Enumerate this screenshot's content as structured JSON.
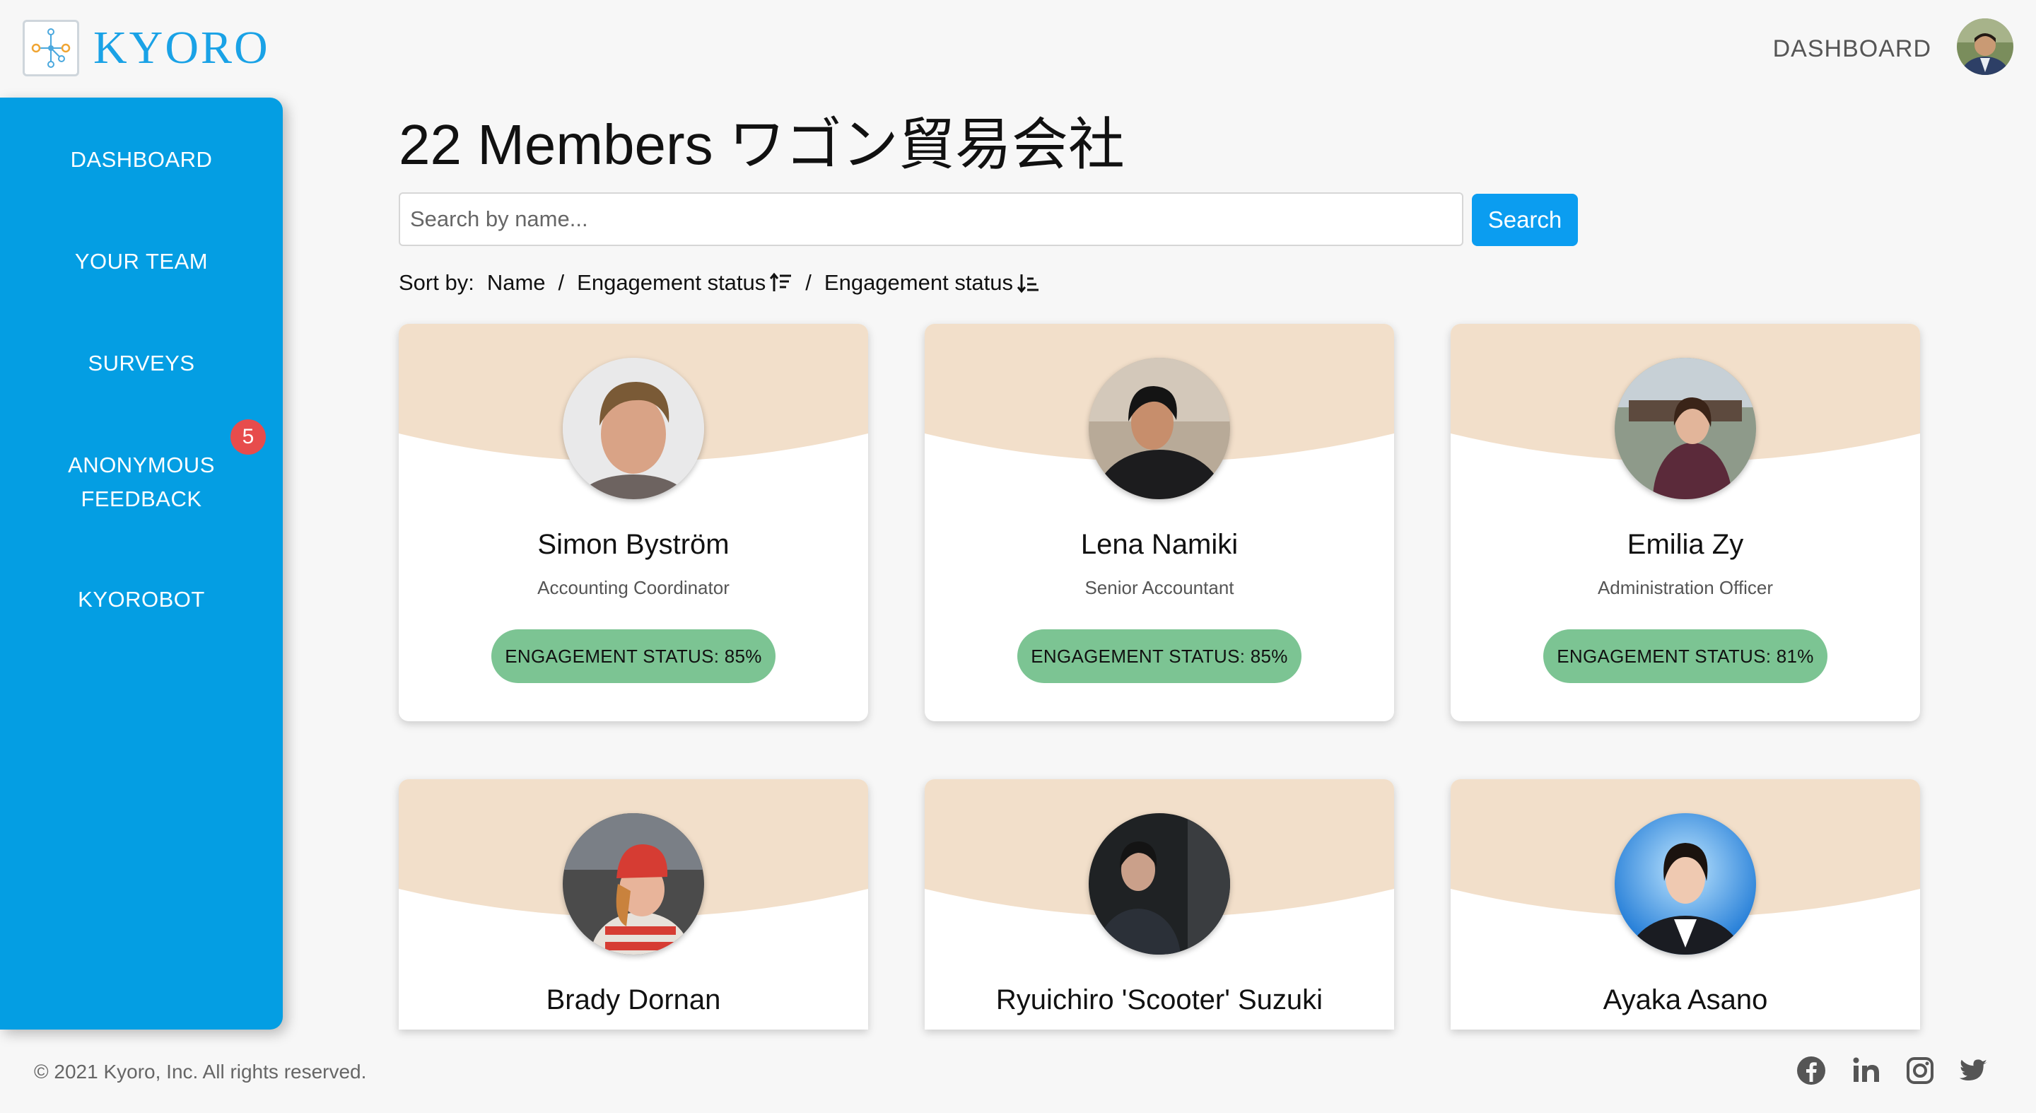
{
  "header": {
    "logo_text": "KYORO",
    "dashboard_link": "DASHBOARD",
    "avatar_icon": "user-avatar"
  },
  "sidebar": {
    "items": [
      {
        "label": "DASHBOARD"
      },
      {
        "label": "YOUR TEAM"
      },
      {
        "label": "SURVEYS"
      },
      {
        "label": "ANONYMOUS FEEDBACK",
        "badge": "5"
      },
      {
        "label": "KYOROBOT"
      }
    ]
  },
  "main": {
    "title": "22 Members ワゴン貿易会社",
    "search": {
      "placeholder": "Search by name...",
      "value": "",
      "button_label": "Search"
    },
    "sort": {
      "label": "Sort by:",
      "options": [
        "Name",
        "Engagement status",
        "Engagement status"
      ],
      "separator": "/"
    }
  },
  "members": [
    {
      "name": "Simon Byström",
      "role": "Accounting Coordinator",
      "engagement_status": "ENGAGEMENT STATUS: 85%"
    },
    {
      "name": "Lena Namiki",
      "role": "Senior Accountant",
      "engagement_status": "ENGAGEMENT STATUS: 85%"
    },
    {
      "name": "Emilia Zy",
      "role": "Administration Officer",
      "engagement_status": "ENGAGEMENT STATUS: 81%"
    },
    {
      "name": "Brady Dornan"
    },
    {
      "name": "Ryuichiro 'Scooter' Suzuki"
    },
    {
      "name": "Ayaka Asano"
    }
  ],
  "footer": {
    "copyright": "© 2021 Kyoro, Inc. All rights reserved.",
    "social_icons": [
      "facebook-icon",
      "linkedin-icon",
      "instagram-icon",
      "twitter-icon"
    ]
  },
  "colors": {
    "brand_blue": "#049ee3",
    "search_button": "#0b9df0",
    "engagement_green": "#7cc493",
    "card_header": "#f2dfca",
    "badge_red": "#e74c4c"
  }
}
